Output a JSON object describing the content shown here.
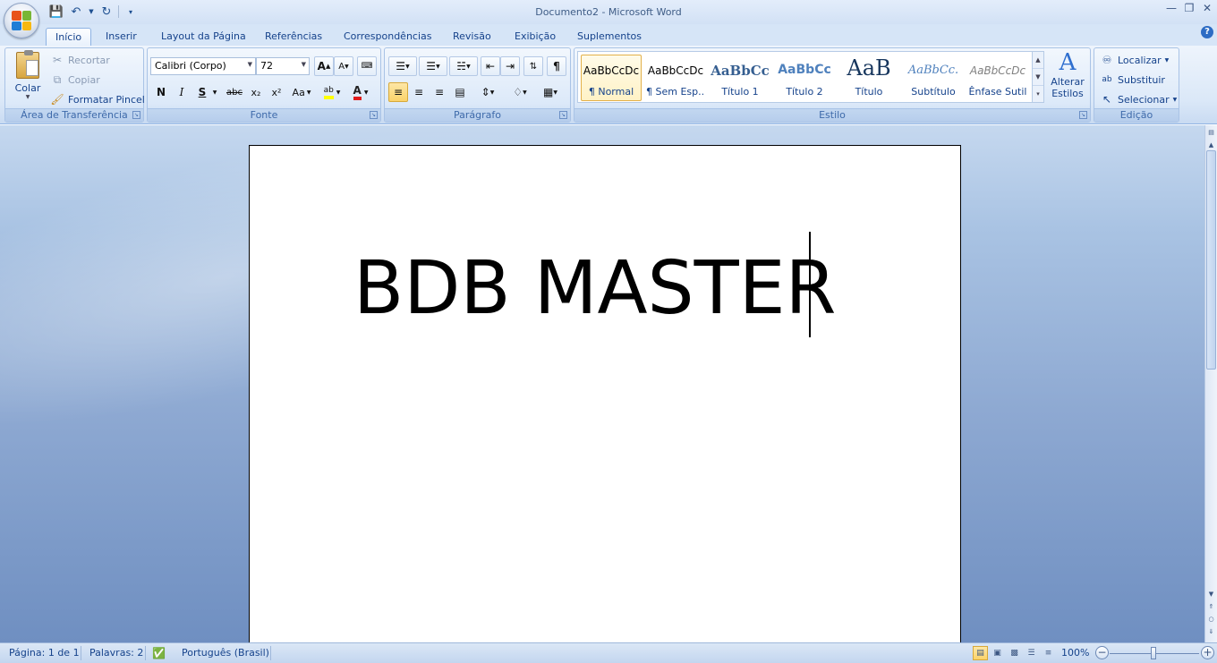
{
  "window": {
    "title": "Documento2 - Microsoft Word"
  },
  "tabs": [
    "Início",
    "Inserir",
    "Layout da Página",
    "Referências",
    "Correspondências",
    "Revisão",
    "Exibição",
    "Suplementos"
  ],
  "clipboard": {
    "paste_label": "Colar",
    "cut_label": "Recortar",
    "copy_label": "Copiar",
    "format_painter_label": "Formatar Pincel",
    "group_label": "Área de Transferência"
  },
  "font": {
    "font_name": "Calibri (Corpo)",
    "font_size": "72",
    "bold": "N",
    "italic": "I",
    "underline": "S",
    "strike": "abc",
    "subscript": "x₂",
    "superscript": "x²",
    "change_case": "Aa",
    "grow": "A",
    "shrink": "A",
    "group_label": "Fonte"
  },
  "paragraph": {
    "group_label": "Parágrafo",
    "show_marks": "¶"
  },
  "styles": {
    "items": [
      {
        "preview": "AaBbCcDc",
        "name": "¶ Normal"
      },
      {
        "preview": "AaBbCcDc",
        "name": "¶ Sem Esp..."
      },
      {
        "preview": "AaBbCc",
        "name": "Título 1"
      },
      {
        "preview": "AaBbCc",
        "name": "Título 2"
      },
      {
        "preview": "AaB",
        "name": "Título"
      },
      {
        "preview": "AaBbCc.",
        "name": "Subtítulo"
      },
      {
        "preview": "AaBbCcDc",
        "name": "Ênfase Sutil"
      }
    ],
    "change_styles_line1": "Alterar",
    "change_styles_line2": "Estilos",
    "group_label": "Estilo"
  },
  "editing": {
    "find_label": "Localizar",
    "replace_label": "Substituir",
    "select_label": "Selecionar",
    "group_label": "Edição"
  },
  "document": {
    "text": "BDB MASTER"
  },
  "status": {
    "page": "Página: 1 de 1",
    "words": "Palavras: 2",
    "language": "Português (Brasil)",
    "zoom": "100%",
    "zoom_level_percent": 100
  },
  "colors": {
    "accent": "#15428b",
    "ribbon": "#dbe8f8",
    "selected": "#fbd36a"
  }
}
